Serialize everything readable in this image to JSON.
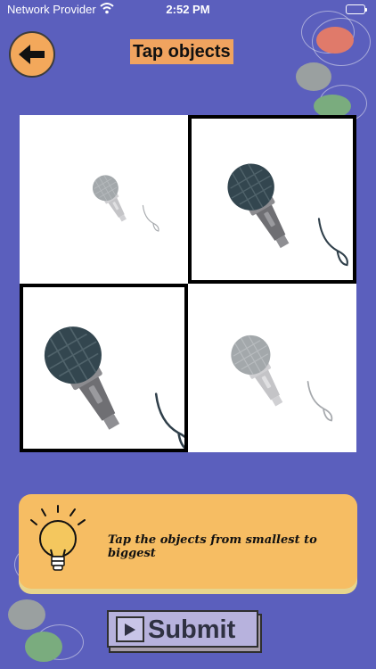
{
  "status_bar": {
    "carrier": "Network Provider",
    "time": "2:52 PM",
    "wifi_icon": "wifi-icon",
    "battery_icon": "battery-icon"
  },
  "header": {
    "back_icon": "arrow-left-icon",
    "title": "Tap objects"
  },
  "grid": {
    "object": "microphone",
    "tiles": [
      {
        "size": "smallest",
        "selected": false
      },
      {
        "size": "large",
        "selected": true
      },
      {
        "size": "biggest",
        "selected": true
      },
      {
        "size": "small",
        "selected": false
      }
    ]
  },
  "hint": {
    "icon": "lightbulb-icon",
    "text": "Tap the objects from smallest to biggest"
  },
  "submit": {
    "icon": "play-icon",
    "label": "Submit"
  },
  "colors": {
    "background": "#5b5fbd",
    "accent_orange": "#f0a35f",
    "hint_yellow": "#f6bd63",
    "selected_border": "#000000"
  }
}
